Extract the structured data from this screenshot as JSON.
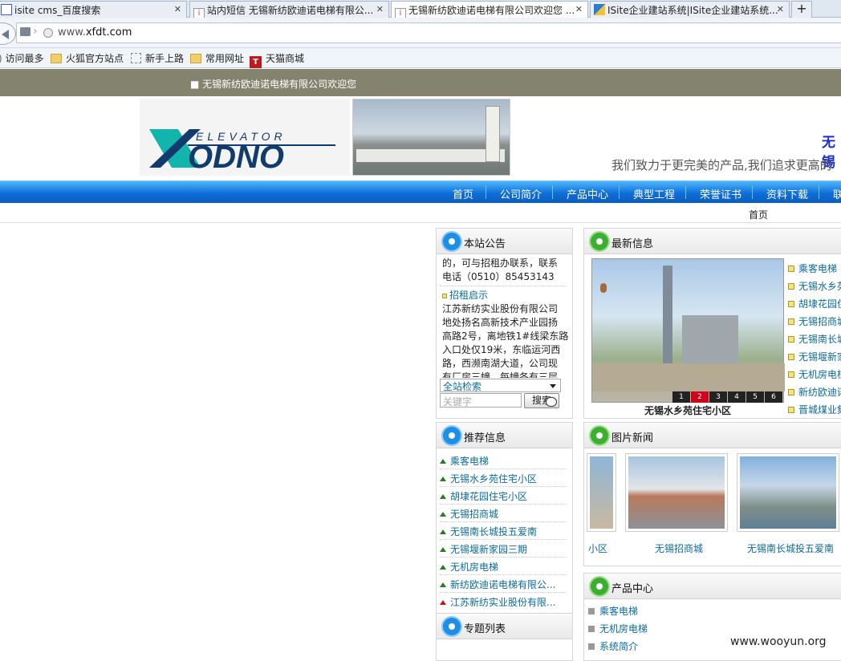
{
  "tabs": [
    {
      "title": "isite cms_百度搜索"
    },
    {
      "title": "站内短信 无锡新纺欧迪诺电梯有限公..."
    },
    {
      "title": "无锡新纺欧迪诺电梯有限公司欢迎您 ..."
    },
    {
      "title": "ISite企业建站系统|ISite企业建站系统..."
    }
  ],
  "new_tab": "+",
  "address": {
    "prefix": "www.",
    "domain": "xfdt.com"
  },
  "bookmarks": [
    "访问最多",
    "火狐官方站点",
    "新手上路",
    "常用网址",
    "天猫商城"
  ],
  "site": {
    "welcome": "■ 无锡新纺欧迪诺电梯有限公司欢迎您",
    "logo_top": "ELEVATOR",
    "logo_main": "XODNO",
    "slogan": "我们致力于更完美的产品,我们追求更高的",
    "title_fragment": "无锡"
  },
  "nav": [
    "首页",
    "公司简介",
    "产品中心",
    "典型工程",
    "荣誉证书",
    "资料下载",
    "联"
  ],
  "breadcrumb": "首页",
  "notice": {
    "title": "本站公告",
    "text1": "的，可与招租办联系，联系",
    "text2": "电话（0510）85453143",
    "item": "招租启示",
    "body": [
      "江苏新纺实业股份有限公司",
      "地处扬名高新技术产业园扬",
      "高路2号，离地铁1#线梁东路",
      "入口处仅19米，东临运河西",
      "路，西濒南湖大道，公司现",
      "有厂房三幢，每幢各有三层"
    ],
    "search_scope": "全站检索",
    "keyword_placeholder": "关键字",
    "search_btn": "搜索"
  },
  "latest": {
    "title": "最新信息",
    "caption": "无锡水乡苑住宅小区",
    "pages": [
      "1",
      "2",
      "3",
      "4",
      "5",
      "6"
    ],
    "items": [
      "乘客电梯",
      "无锡水乡苑",
      "胡埭花园住",
      "无锡招商城",
      "无锡南长城",
      "无锡堰新家",
      "无机房电梯",
      "新纺欧迪诺",
      "晋城煤业集"
    ]
  },
  "recommend": {
    "title": "推荐信息",
    "items": [
      "乘客电梯",
      "无锡水乡苑住宅小区",
      "胡埭花园住宅小区",
      "无锡招商城",
      "无锡南长城投五爱南",
      "无锡堰新家园三期",
      "无机房电梯",
      "新纺欧迪诺电梯有限公...",
      "江苏新纺实业股份有限..."
    ]
  },
  "topics": {
    "title": "专题列表"
  },
  "photos": {
    "title": "图片新闻",
    "labels": [
      "小区",
      "无锡招商城",
      "无锡南长城投五爱南"
    ]
  },
  "products": {
    "title": "产品中心",
    "items": [
      "乘客电梯",
      "无机房电梯",
      "系统简介"
    ]
  },
  "watermark": "www.wooyun.org"
}
